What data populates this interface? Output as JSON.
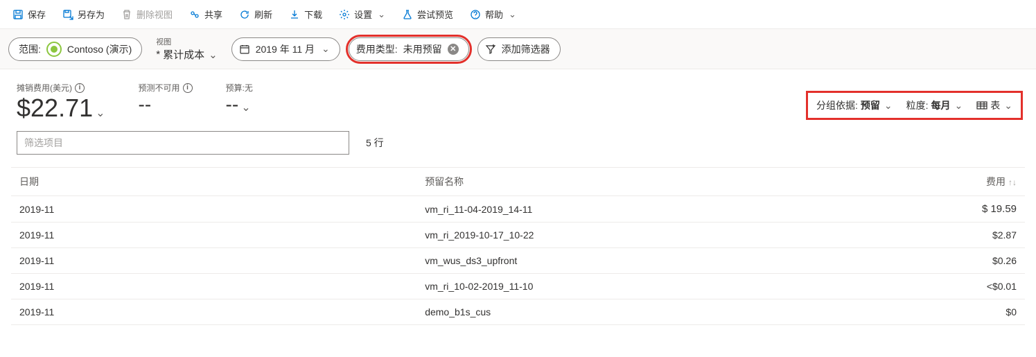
{
  "toolbar": {
    "save": "保存",
    "save_as": "另存为",
    "delete_view": "删除视图",
    "share": "共享",
    "refresh": "刷新",
    "download": "下载",
    "settings": "设置",
    "try_preview": "尝试预览",
    "help": "帮助"
  },
  "filterbar": {
    "scope_label": "范围:",
    "scope_name": "Contoso (演示)",
    "view_label": "视图",
    "view_value": "累计成本",
    "date_value": "2019 年 11 月",
    "charge_type_label": "费用类型:",
    "charge_type_value": "未用预留",
    "add_filter": "添加筛选器"
  },
  "summary": {
    "actual_label": "摊销费用(美元)",
    "actual_value": "$22.71",
    "forecast_label": "预测不可用",
    "forecast_value": "--",
    "budget_label": "预算:无",
    "budget_value": "--"
  },
  "right_controls": {
    "group_label": "分组依据:",
    "group_value": "预留",
    "granularity_label": "粒度:",
    "granularity_value": "每月",
    "view_type": "表"
  },
  "filter_items": {
    "placeholder": "筛选项目",
    "row_count": "5 行"
  },
  "table": {
    "headers": {
      "date": "日期",
      "reservation_name": "预留名称",
      "cost": "费用"
    },
    "rows": [
      {
        "date": "2019-11",
        "name": "vm_ri_11-04-2019_14-11",
        "cost": "$ 19.59"
      },
      {
        "date": "2019-11",
        "name": "vm_ri_2019-10-17_10-22",
        "cost": "$2.87"
      },
      {
        "date": "2019-11",
        "name": "vm_wus_ds3_upfront",
        "cost": "$0.26"
      },
      {
        "date": "2019-11",
        "name": "vm_ri_10-02-2019_11-10",
        "cost": "<$0.01"
      },
      {
        "date": "2019-11",
        "name": "demo_b1s_cus",
        "cost": "$0"
      }
    ]
  }
}
